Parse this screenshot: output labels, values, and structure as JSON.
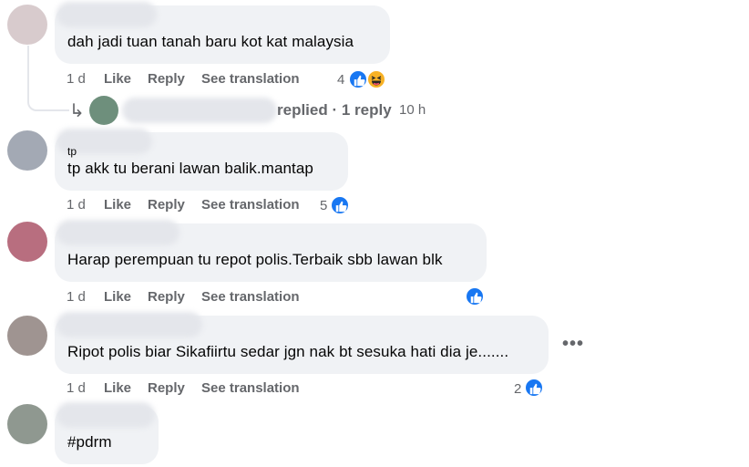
{
  "comments": [
    {
      "text": "dah jadi tuan tanah baru kot kat malaysia",
      "time": "1 d",
      "like": "Like",
      "reply": "Reply",
      "translate": "See translation",
      "reaction_count": "4",
      "avatar_color": "#d8cbcd"
    },
    {
      "text": "tp akk tu berani lawan balik.mantap",
      "time": "1 d",
      "like": "Like",
      "reply": "Reply",
      "translate": "See translation",
      "reaction_count": "5",
      "avatar_color": "#a3a9b4"
    },
    {
      "text": "Harap perempuan tu repot polis.Terbaik sbb lawan blk",
      "time": "1 d",
      "like": "Like",
      "reply": "Reply",
      "translate": "See translation",
      "reaction_count": "",
      "avatar_color": "#b86e7f"
    },
    {
      "text": "Ripot polis biar Sikafiirtu sedar jgn nak bt sesuka hati dia je.......",
      "time": "1 d",
      "like": "Like",
      "reply": "Reply",
      "translate": "See translation",
      "reaction_count": "2",
      "avatar_color": "#9f9491"
    },
    {
      "text": "#pdrm",
      "avatar_color": "#8f9890"
    }
  ],
  "reply_thread": {
    "label": "replied · 1 reply",
    "time": "10 h",
    "avatar_color": "#6e8f7c"
  },
  "partial_name_glyph": "tp",
  "colors": {
    "accent": "#1877f2",
    "bubble": "#f0f2f5",
    "muted": "#65676b"
  },
  "icons": [
    "like-icon",
    "haha-icon",
    "reply-arrow-icon",
    "more-options-icon"
  ]
}
